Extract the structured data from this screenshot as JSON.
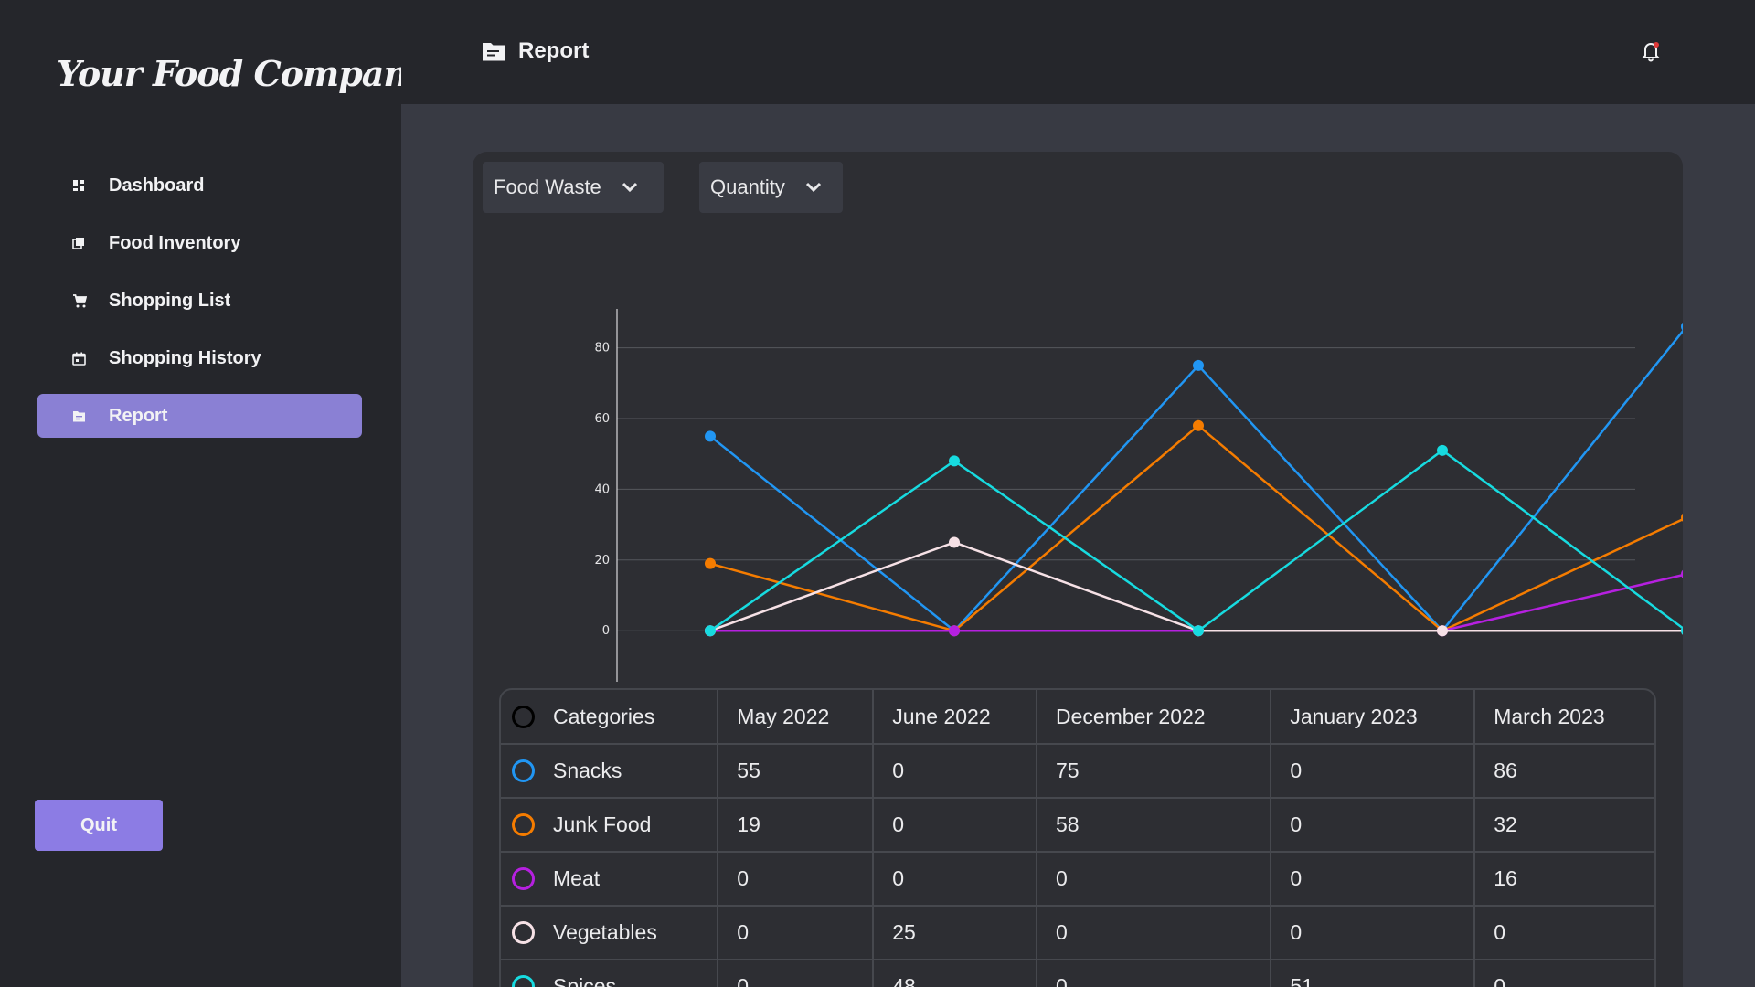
{
  "app": {
    "title": "Your Food Companion"
  },
  "sidebar": {
    "items": [
      {
        "label": "Dashboard",
        "icon": "dashboard-icon"
      },
      {
        "label": "Food Inventory",
        "icon": "inventory-icon"
      },
      {
        "label": "Shopping List",
        "icon": "cart-icon"
      },
      {
        "label": "Shopping History",
        "icon": "calendar-icon"
      },
      {
        "label": "Report",
        "icon": "folder-icon",
        "active": true
      }
    ],
    "quit_label": "Quit"
  },
  "header": {
    "title": "Report",
    "icon": "folder-icon",
    "notification_icon": "bell-icon"
  },
  "filters": {
    "metric": "Food Waste",
    "measure": "Quantity"
  },
  "colors": {
    "Snacks": "#2196f3",
    "Junk Food": "#f57c00",
    "Meat": "#b620e0",
    "Vegetables": "#f6e1e6",
    "Spices": "#17dbe0",
    "accent": "#8c7ce4"
  },
  "chart_data": {
    "type": "line",
    "categories": [
      "May 2022",
      "June 2022",
      "December 2022",
      "January 2023",
      "March 2023"
    ],
    "series": [
      {
        "name": "Snacks",
        "values": [
          55,
          0,
          75,
          0,
          86
        ]
      },
      {
        "name": "Junk Food",
        "values": [
          19,
          0,
          58,
          0,
          32
        ]
      },
      {
        "name": "Meat",
        "values": [
          0,
          0,
          0,
          0,
          16
        ]
      },
      {
        "name": "Vegetables",
        "values": [
          0,
          25,
          0,
          0,
          0
        ]
      },
      {
        "name": "Spices",
        "values": [
          0,
          48,
          0,
          51,
          0
        ]
      }
    ],
    "yticks": [
      0,
      20,
      40,
      60,
      80
    ],
    "ylim": [
      -17,
      91
    ],
    "grid": true
  },
  "table": {
    "headers": [
      "Categories",
      "May 2022",
      "June 2022",
      "December 2022",
      "January 2023",
      "March 2023"
    ],
    "rows": [
      {
        "category": "Snacks",
        "cells": [
          "55",
          "0",
          "75",
          "0",
          "86"
        ]
      },
      {
        "category": "Junk Food",
        "cells": [
          "19",
          "0",
          "58",
          "0",
          "32"
        ]
      },
      {
        "category": "Meat",
        "cells": [
          "0",
          "0",
          "0",
          "0",
          "16"
        ]
      },
      {
        "category": "Vegetables",
        "cells": [
          "0",
          "25",
          "0",
          "0",
          "0"
        ]
      },
      {
        "category": "Spices",
        "cells": [
          "0",
          "48",
          "0",
          "51",
          "0"
        ]
      }
    ]
  }
}
